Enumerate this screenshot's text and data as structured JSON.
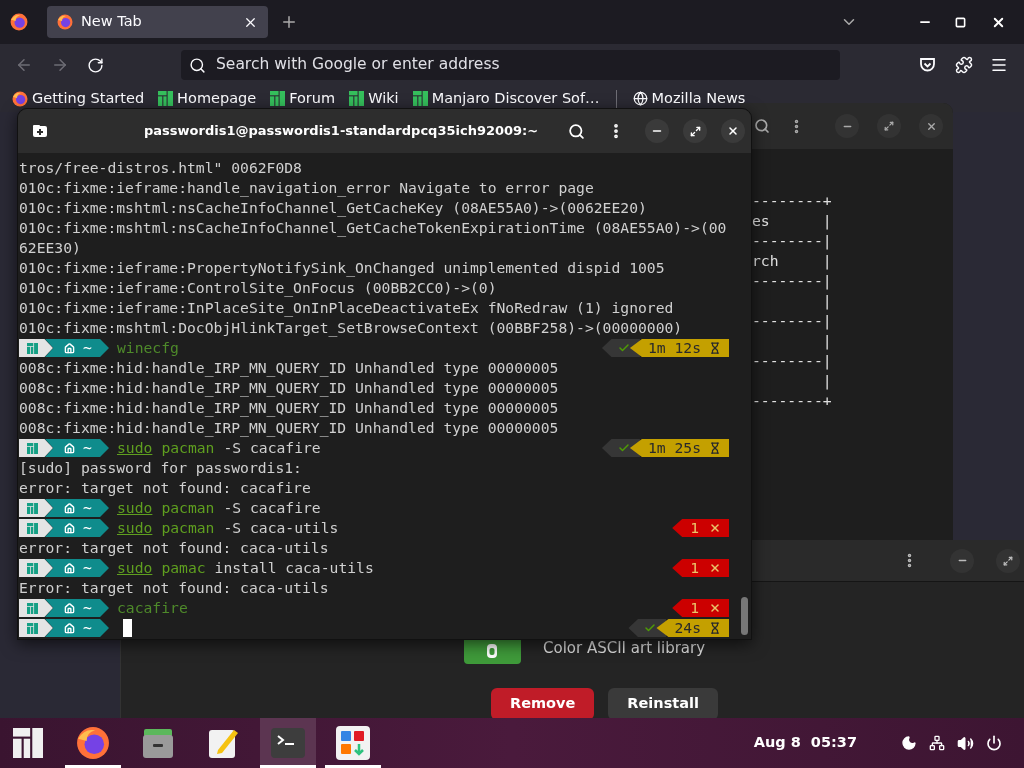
{
  "browser": {
    "tabs": [
      {
        "label": "New Tab",
        "selected": true
      }
    ],
    "address_bar": {
      "placeholder": "Search with Google or enter address"
    },
    "bookmarks": [
      {
        "label": "Getting Started",
        "kind": "firefox"
      },
      {
        "label": "Homepage",
        "kind": "manjaro"
      },
      {
        "label": "Forum",
        "kind": "manjaro"
      },
      {
        "label": "Wiki",
        "kind": "manjaro"
      },
      {
        "label": "Manjaro Discover Sof…",
        "kind": "manjaro"
      },
      {
        "label": "Mozilla News",
        "kind": "globe"
      }
    ]
  },
  "back_terminal": {
    "lines": [
      "--------+",
      "es      |",
      "--------|",
      "rch     |",
      "--------|",
      "        |",
      "--------|",
      "        |",
      "--------|",
      "        |",
      "--------+"
    ]
  },
  "software_window": {
    "package_description": "Color ASCII art library",
    "buttons": [
      {
        "label": "Remove",
        "kind": "destructive"
      },
      {
        "label": "Reinstall",
        "kind": "normal"
      }
    ]
  },
  "terminal": {
    "title": "passwordis1@passwordis1-standardpcq35ich92009:~",
    "lines": [
      {
        "kind": "output",
        "text": "tros/free-distros.html\" 0062F0D8"
      },
      {
        "kind": "output",
        "text": "010c:fixme:ieframe:handle_navigation_error Navigate to error page"
      },
      {
        "kind": "output",
        "text": "010c:fixme:mshtml:nsCacheInfoChannel_GetCacheKey (08AE55A0)->(0062EE20)"
      },
      {
        "kind": "output",
        "text": "010c:fixme:mshtml:nsCacheInfoChannel_GetCacheTokenExpirationTime (08AE55A0)->(00"
      },
      {
        "kind": "output",
        "text": "62EE30)"
      },
      {
        "kind": "output",
        "text": "010c:fixme:ieframe:PropertyNotifySink_OnChanged unimplemented dispid 1005"
      },
      {
        "kind": "output",
        "text": "010c:fixme:ieframe:ControlSite_OnFocus (00BB2CC0)->(0)"
      },
      {
        "kind": "output",
        "text": "010c:fixme:ieframe:InPlaceSite_OnInPlaceDeactivateEx fNoRedraw (1) ignored"
      },
      {
        "kind": "output",
        "text": "010c:fixme:mshtml:DocObjHlinkTarget_SetBrowseContext (00BBF258)->(00000000)"
      },
      {
        "kind": "prompt",
        "directory": "~",
        "cursor": false,
        "command": [
          {
            "text": "winecfg",
            "kind": "pending"
          }
        ],
        "status": {
          "kind": "ok",
          "text": "1m 12s"
        }
      },
      {
        "kind": "output",
        "text": "008c:fixme:hid:handle_IRP_MN_QUERY_ID Unhandled type 00000005"
      },
      {
        "kind": "output",
        "text": "008c:fixme:hid:handle_IRP_MN_QUERY_ID Unhandled type 00000005"
      },
      {
        "kind": "output",
        "text": "008c:fixme:hid:handle_IRP_MN_QUERY_ID Unhandled type 00000005"
      },
      {
        "kind": "output",
        "text": "008c:fixme:hid:handle_IRP_MN_QUERY_ID Unhandled type 00000005"
      },
      {
        "kind": "prompt",
        "directory": "~",
        "cursor": false,
        "command": [
          {
            "text": "sudo",
            "kind": "path"
          },
          {
            "text": "pacman",
            "kind": "command"
          },
          {
            "text": "-S cacafire",
            "kind": "arg"
          }
        ],
        "status": {
          "kind": "ok",
          "text": "1m 25s"
        }
      },
      {
        "kind": "output",
        "text": "[sudo] password for passwordis1:"
      },
      {
        "kind": "output",
        "text": "error: target not found: cacafire"
      },
      {
        "kind": "prompt",
        "directory": "~",
        "cursor": false,
        "command": [
          {
            "text": "sudo",
            "kind": "path"
          },
          {
            "text": "pacman",
            "kind": "command"
          },
          {
            "text": "-S cacafire",
            "kind": "arg"
          }
        ]
      },
      {
        "kind": "prompt",
        "directory": "~",
        "cursor": false,
        "command": [
          {
            "text": "sudo",
            "kind": "path"
          },
          {
            "text": "pacman",
            "kind": "command"
          },
          {
            "text": "-S caca-utils",
            "kind": "arg"
          }
        ],
        "status": {
          "kind": "error",
          "text": "1"
        }
      },
      {
        "kind": "output",
        "text": "error: target not found: caca-utils"
      },
      {
        "kind": "prompt",
        "directory": "~",
        "cursor": false,
        "command": [
          {
            "text": "sudo",
            "kind": "path"
          },
          {
            "text": "pamac",
            "kind": "command"
          },
          {
            "text": "install caca-utils",
            "kind": "arg"
          }
        ],
        "status": {
          "kind": "error",
          "text": "1"
        }
      },
      {
        "kind": "output",
        "text": "Error: target not found: caca-utils"
      },
      {
        "kind": "prompt",
        "directory": "~",
        "cursor": false,
        "command": [
          {
            "text": "cacafire",
            "kind": "pending"
          }
        ],
        "status": {
          "kind": "error",
          "text": "1"
        }
      },
      {
        "kind": "prompt",
        "directory": "~",
        "cursor": true,
        "status": {
          "kind": "ok",
          "text": "24s"
        }
      }
    ]
  },
  "taskbar": {
    "apps": [
      {
        "kind": "menu",
        "selected": false,
        "running": false
      },
      {
        "kind": "firefox",
        "selected": false,
        "running": true
      },
      {
        "kind": "files",
        "selected": false,
        "running": false
      },
      {
        "kind": "editor",
        "selected": false,
        "running": false
      },
      {
        "kind": "terminal",
        "selected": true,
        "running": true
      },
      {
        "kind": "software",
        "selected": false,
        "running": true
      }
    ],
    "date": "Aug 8",
    "time": "05:37"
  }
}
